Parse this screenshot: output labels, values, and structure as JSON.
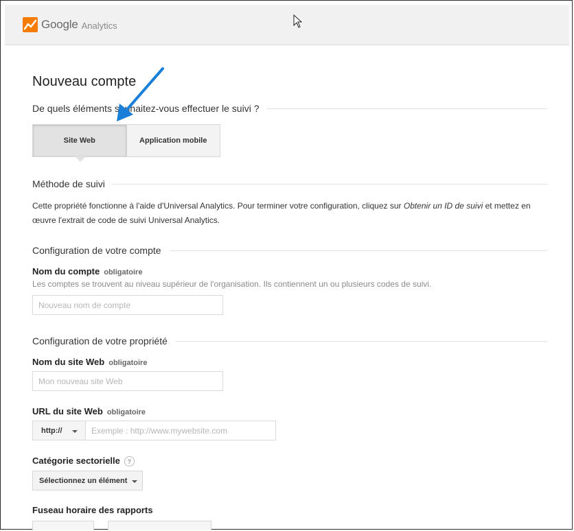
{
  "header": {
    "brand_google": "Google",
    "brand_analytics": "Analytics"
  },
  "page": {
    "title": "Nouveau compte"
  },
  "tracking_question": {
    "heading": "De quels éléments souhaitez-vous effectuer le suivi ?",
    "options": [
      {
        "label": "Site Web",
        "selected": true
      },
      {
        "label": "Application mobile",
        "selected": false
      }
    ]
  },
  "method": {
    "heading": "Méthode de suivi",
    "text_before": "Cette propriété fonctionne à l'aide d'Universal Analytics. Pour terminer votre configuration, cliquez sur ",
    "text_link": "Obtenir un ID de suivi",
    "text_after": " et mettez en œuvre l'extrait de code de suivi Universal Analytics."
  },
  "account_config": {
    "heading": "Configuration de votre compte",
    "account_name_label": "Nom du compte",
    "required": "obligatoire",
    "account_help": "Les comptes se trouvent au niveau supérieur de l'organisation. Ils contiennent un ou plusieurs codes de suivi.",
    "account_placeholder": "Nouveau nom de compte"
  },
  "property_config": {
    "heading": "Configuration de votre propriété",
    "site_name_label": "Nom du site Web",
    "site_name_placeholder": "Mon nouveau site Web",
    "url_label": "URL du site Web",
    "url_protocol": "http://",
    "url_placeholder": "Exemple : http://www.mywebsite.com",
    "category_label": "Catégorie sectorielle",
    "category_help": "?",
    "category_select": "Sélectionnez un élément",
    "timezone_label": "Fuseau horaire des rapports"
  },
  "colors": {
    "header_bg": "#f1f1f1",
    "annotation_arrow": "#1a7fd8",
    "logo_orange": "#f57c00"
  }
}
